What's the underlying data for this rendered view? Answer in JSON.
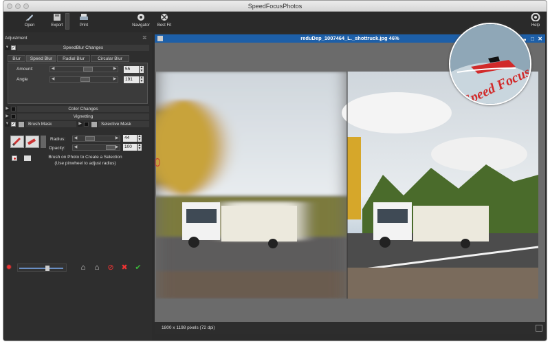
{
  "app": {
    "title": "SpeedFocusPhotos"
  },
  "toolbar": {
    "open": "Open",
    "export": "Export",
    "print": "Print",
    "navigator": "Navigator",
    "best_fit": "Best Fit",
    "help": "Help"
  },
  "panel": {
    "title": "Adjustment",
    "speedblur_header": "SpeedBlur Changes",
    "tabs": [
      "Blur",
      "Speed Blur",
      "Radial Blur",
      "Circular Blur"
    ],
    "amount_label": "Amount:",
    "amount_value": "55",
    "angle_label": "Angle",
    "angle_value": "191",
    "color_changes": "Color Changes",
    "vignetting": "Vignetting",
    "brush_mask": "Brush Mask",
    "selective_mask": "Selective Mask",
    "radius_label": "Radius:",
    "radius_value": "44",
    "opacity_label": "Opacity:",
    "opacity_value": "100",
    "brush_hint_1": "Brush on Photo to Create a Selection",
    "brush_hint_2": "(Use pinwheel to adjust radius)"
  },
  "image_window": {
    "title": "reduDep_1007464_L._shottruck.jpg 46%",
    "status": "1800 x 1198 pixels (72 dpi)"
  },
  "logo": {
    "text": "Speed Focus"
  },
  "colors": {
    "accent_blue": "#1d5fa8",
    "panel": "#2e2e2e",
    "green_check": "#3ab53a",
    "red_x": "#d43b3b"
  }
}
